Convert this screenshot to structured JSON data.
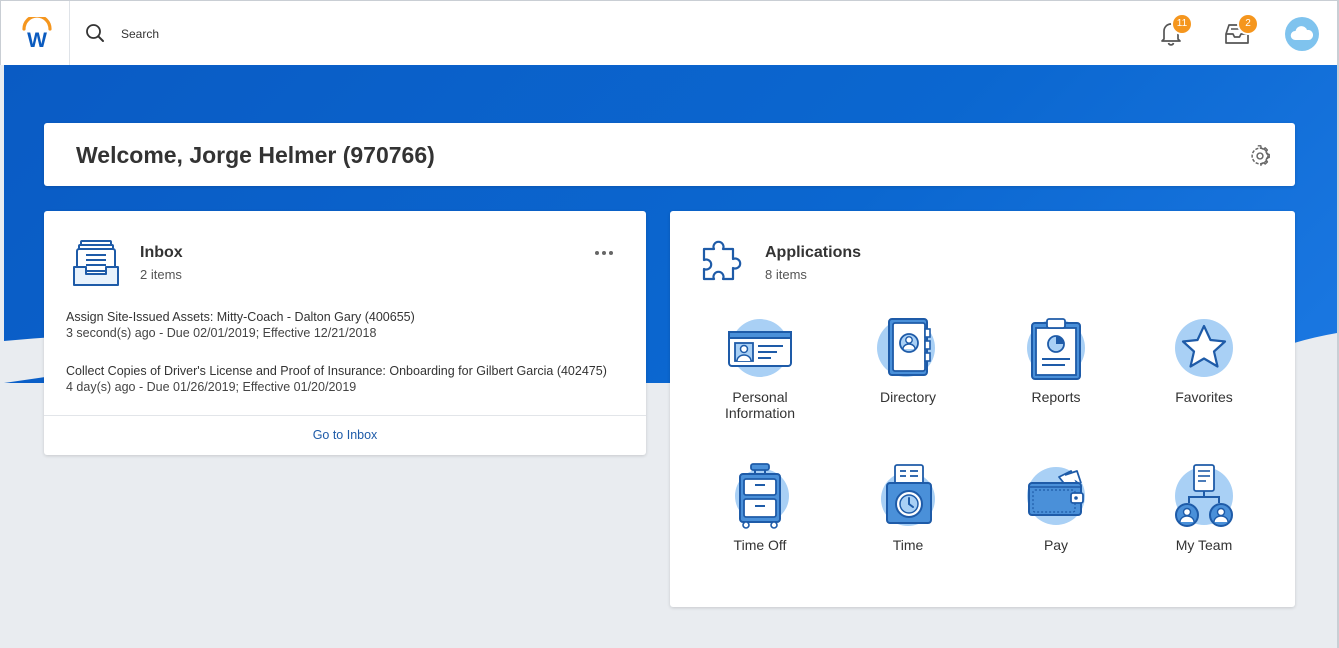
{
  "topbar": {
    "search_placeholder": "Search",
    "notifications_count": "11",
    "inbox_count": "2",
    "logo_letter": "W"
  },
  "welcome": {
    "title": "Welcome, Jorge Helmer (970766)"
  },
  "inbox": {
    "title": "Inbox",
    "count": "2 items",
    "tasks": [
      {
        "title": "Assign Site-Issued Assets: Mitty-Coach - Dalton Gary (400655)",
        "meta": "3 second(s) ago - Due 02/01/2019; Effective 12/21/2018"
      },
      {
        "title": "Collect Copies of Driver's License and Proof of Insurance: Onboarding for Gilbert Garcia (402475)",
        "meta": "4 day(s) ago - Due 01/26/2019; Effective 01/20/2019"
      }
    ],
    "go_link": "Go to Inbox"
  },
  "applications": {
    "title": "Applications",
    "count": "8 items",
    "items": [
      {
        "label": "Personal\nInformation",
        "icon": "id-card-icon"
      },
      {
        "label": "Directory",
        "icon": "address-book-icon"
      },
      {
        "label": "Reports",
        "icon": "clipboard-chart-icon"
      },
      {
        "label": "Favorites",
        "icon": "star-icon"
      },
      {
        "label": "Time Off",
        "icon": "suitcase-icon"
      },
      {
        "label": "Time",
        "icon": "timeclock-icon"
      },
      {
        "label": "Pay",
        "icon": "wallet-icon"
      },
      {
        "label": "My Team",
        "icon": "team-icon"
      }
    ]
  },
  "colors": {
    "brand_blue": "#0b67d0",
    "badge_orange": "#f5961e",
    "icon_blue": "#1e5ba8",
    "icon_light": "#a9d0f5"
  }
}
